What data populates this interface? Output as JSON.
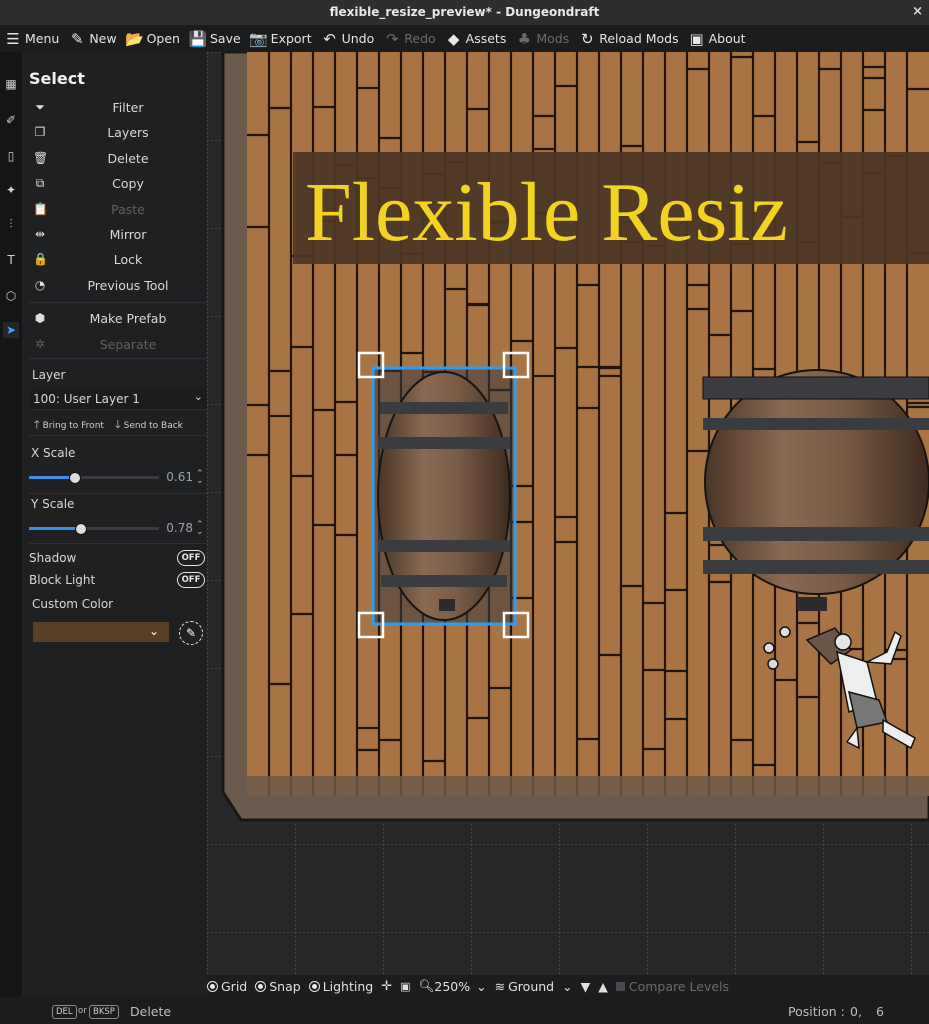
{
  "window": {
    "title": "flexible_resize_preview* - Dungeondraft",
    "close_glyph": "×"
  },
  "menubar": [
    {
      "label": "Menu",
      "icon": "hamburger-icon",
      "glyph": "☰",
      "enabled": true
    },
    {
      "label": "New",
      "icon": "new-doc-icon",
      "glyph": "✎",
      "enabled": true
    },
    {
      "label": "Open",
      "icon": "folder-open-icon",
      "glyph": "📂",
      "enabled": true
    },
    {
      "label": "Save",
      "icon": "floppy-icon",
      "glyph": "💾",
      "enabled": true
    },
    {
      "label": "Export",
      "icon": "camera-icon",
      "glyph": "📷",
      "enabled": true
    },
    {
      "label": "Undo",
      "icon": "undo-icon",
      "glyph": "↶",
      "enabled": true
    },
    {
      "label": "Redo",
      "icon": "redo-icon",
      "glyph": "↷",
      "enabled": false
    },
    {
      "label": "Assets",
      "icon": "gem-icon",
      "glyph": "◆",
      "enabled": true
    },
    {
      "label": "Mods",
      "icon": "puzzle-icon",
      "glyph": "♣",
      "enabled": false
    },
    {
      "label": "Reload Mods",
      "icon": "reload-icon",
      "glyph": "↻",
      "enabled": true
    },
    {
      "label": "About",
      "icon": "book-icon",
      "glyph": "▣",
      "enabled": true
    }
  ],
  "toolstrip": [
    {
      "name": "map-icon",
      "glyph": "▦",
      "active": false
    },
    {
      "name": "brush-icon",
      "glyph": "✐",
      "active": false
    },
    {
      "name": "book-icon",
      "glyph": "▯",
      "active": false
    },
    {
      "name": "scatter-icon",
      "glyph": "✦",
      "active": false
    },
    {
      "name": "sliders-icon",
      "glyph": "⫶",
      "active": false
    },
    {
      "name": "text-icon",
      "glyph": "T",
      "active": false
    },
    {
      "name": "cube-icon",
      "glyph": "⬡",
      "active": false
    },
    {
      "name": "select-arrow-icon",
      "glyph": "➤",
      "active": true
    }
  ],
  "panel": {
    "title": "Select",
    "commands": [
      {
        "label": "Filter",
        "icon": "funnel-icon",
        "glyph": "⏷",
        "enabled": true
      },
      {
        "label": "Layers",
        "icon": "layers-icon",
        "glyph": "❐",
        "enabled": true
      },
      {
        "label": "Delete",
        "icon": "trash-icon",
        "glyph": "🗑",
        "enabled": true
      },
      {
        "label": "Copy",
        "icon": "copy-icon",
        "glyph": "⧉",
        "enabled": true
      },
      {
        "label": "Paste",
        "icon": "paste-icon",
        "glyph": "📋",
        "enabled": false
      },
      {
        "label": "Mirror",
        "icon": "mirror-icon",
        "glyph": "⇹",
        "enabled": true
      },
      {
        "label": "Lock",
        "icon": "lock-icon",
        "glyph": "🔒",
        "enabled": true
      },
      {
        "label": "Previous Tool",
        "icon": "history-icon",
        "glyph": "◔",
        "enabled": true
      }
    ],
    "prefab": [
      {
        "label": "Make Prefab",
        "icon": "cube-icon",
        "glyph": "⬢",
        "enabled": true
      },
      {
        "label": "Separate",
        "icon": "separate-icon",
        "glyph": "✲",
        "enabled": false
      }
    ],
    "layer_label": "Layer",
    "layer_value": "100: User Layer 1",
    "bring_front": "Bring to Front",
    "send_back": "Send to Back",
    "x_scale_label": "X Scale",
    "x_scale_value": "0.61",
    "x_scale_fraction": 0.35,
    "y_scale_label": "Y Scale",
    "y_scale_value": "0.78",
    "y_scale_fraction": 0.4,
    "shadow_label": "Shadow",
    "shadow_state": "OFF",
    "block_light_label": "Block Light",
    "block_light_state": "OFF",
    "custom_color_label": "Custom Color",
    "custom_color": "#5a3f25"
  },
  "canvas": {
    "banner_text": "Flexible Resiz",
    "banner_color": "#f3d321",
    "floor_color": "#a87444",
    "selection_color": "#2f9cf0"
  },
  "bottombar": {
    "grid": "Grid",
    "snap": "Snap",
    "lighting": "Lighting",
    "zoom": "250%",
    "level": "Ground",
    "compare": "Compare Levels"
  },
  "status": {
    "key1": "DEL",
    "or": "or",
    "key2": "BKSP",
    "action": "Delete",
    "position_label": "Position :",
    "pos_x": "0,",
    "pos_y": "6"
  }
}
